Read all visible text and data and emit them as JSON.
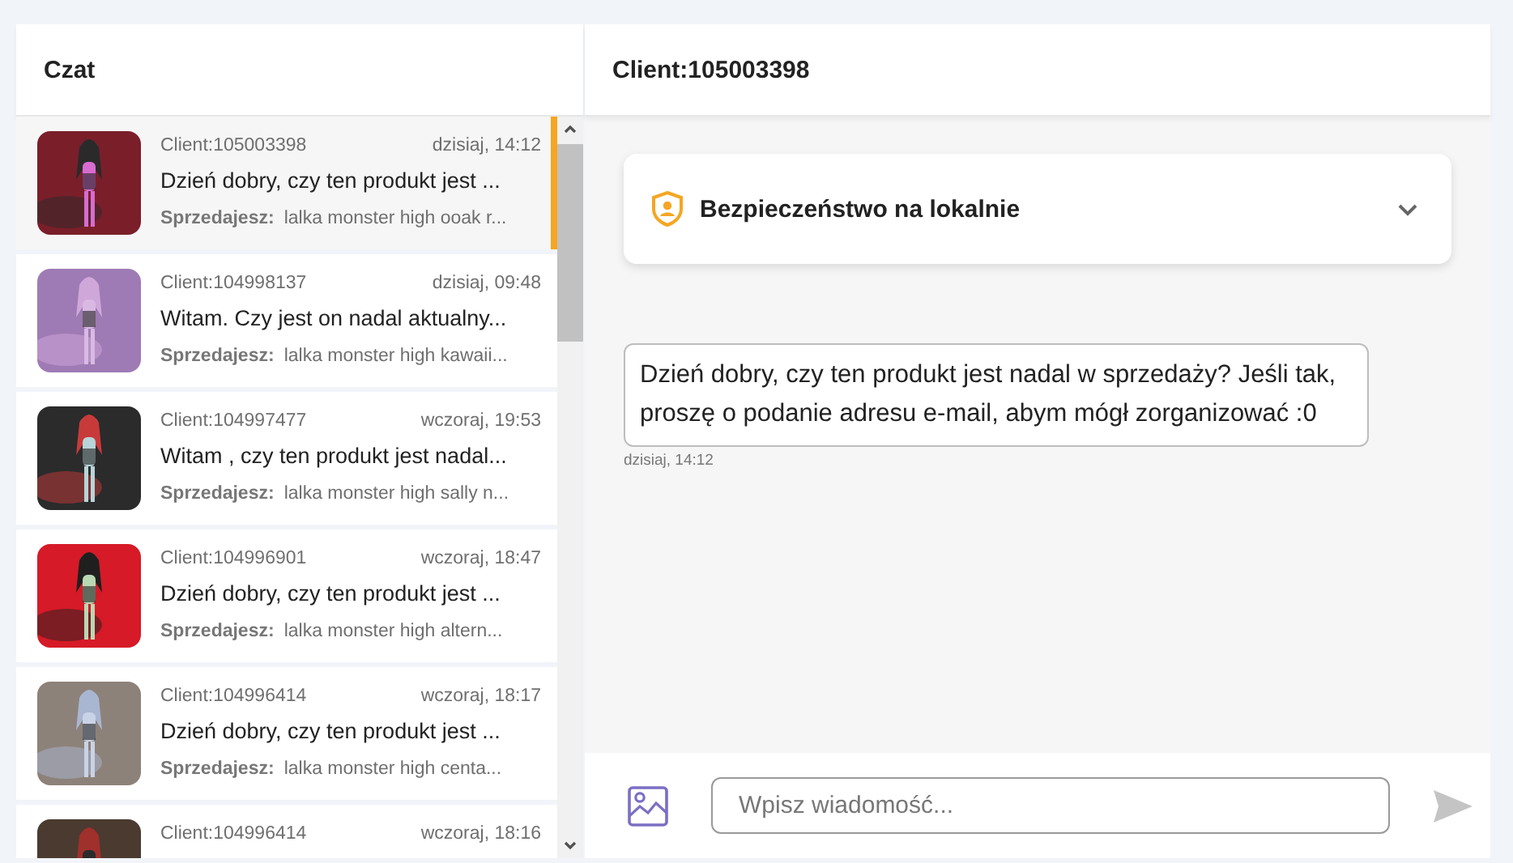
{
  "sidebar": {
    "title": "Czat",
    "conversations": [
      {
        "client": "Client:105003398",
        "time": "dzisiaj, 14:12",
        "message": "Dzień dobry, czy ten produkt jest ...",
        "seller_label": "Sprzedajesz:",
        "product": "lalka monster high ooak r...",
        "selected": true
      },
      {
        "client": "Client:104998137",
        "time": "dzisiaj, 09:48",
        "message": "Witam. Czy jest on nadal aktualny...",
        "seller_label": "Sprzedajesz:",
        "product": "lalka monster high kawaii...",
        "selected": false
      },
      {
        "client": "Client:104997477",
        "time": "wczoraj, 19:53",
        "message": "Witam , czy ten produkt jest nadal...",
        "seller_label": "Sprzedajesz:",
        "product": "lalka monster high sally n...",
        "selected": false
      },
      {
        "client": "Client:104996901",
        "time": "wczoraj, 18:47",
        "message": "Dzień dobry, czy ten produkt jest ...",
        "seller_label": "Sprzedajesz:",
        "product": "lalka monster high altern...",
        "selected": false
      },
      {
        "client": "Client:104996414",
        "time": "wczoraj, 18:17",
        "message": "Dzień dobry, czy ten produkt jest ...",
        "seller_label": "Sprzedajesz:",
        "product": "lalka monster high centa...",
        "selected": false
      },
      {
        "client": "Client:104996414",
        "time": "wczoraj, 18:16",
        "selected": false
      }
    ]
  },
  "chat": {
    "title": "Client:105003398",
    "safety_panel": {
      "title": "Bezpieczeństwo na lokalnie",
      "expanded": false
    },
    "messages": [
      {
        "text": "Dzień dobry, czy ten produkt jest nadal w sprzedaży? Jeśli tak, proszę o podanie adresu e-mail, abym mógł zorganizować :0",
        "time": "dzisiaj, 14:12"
      }
    ],
    "composer": {
      "placeholder": "Wpisz wiadomość..."
    }
  }
}
